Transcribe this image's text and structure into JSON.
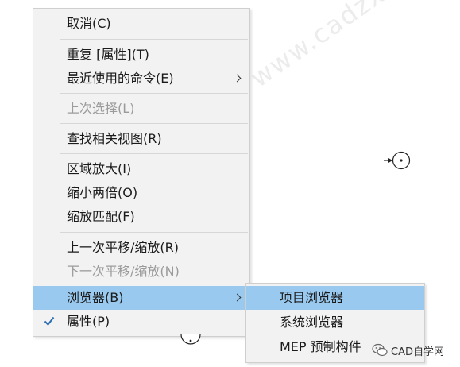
{
  "context_menu": {
    "items": [
      {
        "label": "取消(C)",
        "disabled": false
      },
      {
        "label": "重复 [属性](T)",
        "disabled": false
      },
      {
        "label": "最近使用的命令(E)",
        "disabled": false,
        "submenu": true
      },
      {
        "label": "上次选择(L)",
        "disabled": true
      },
      {
        "label": "查找相关视图(R)",
        "disabled": false
      },
      {
        "label": "区域放大(I)",
        "disabled": false
      },
      {
        "label": "缩小两倍(O)",
        "disabled": false
      },
      {
        "label": "缩放匹配(F)",
        "disabled": false
      },
      {
        "label": "上一次平移/缩放(R)",
        "disabled": false
      },
      {
        "label": "下一次平移/缩放(N)",
        "disabled": true
      },
      {
        "label": "浏览器(B)",
        "disabled": false,
        "submenu": true,
        "highlighted": true
      },
      {
        "label": "属性(P)",
        "disabled": false,
        "checked": true
      }
    ]
  },
  "submenu": {
    "items": [
      {
        "label": "项目浏览器",
        "highlighted": true
      },
      {
        "label": "系统浏览器"
      },
      {
        "label": "MEP 预制构件"
      }
    ]
  },
  "watermark": "CAD自学网 www.cadzxw.com",
  "logo_text": "CAD自学网",
  "colors": {
    "highlight": "#99c9ef",
    "menu_bg": "#f2f2f2",
    "disabled_text": "#9b9b9b",
    "check": "#2b6cb0"
  }
}
